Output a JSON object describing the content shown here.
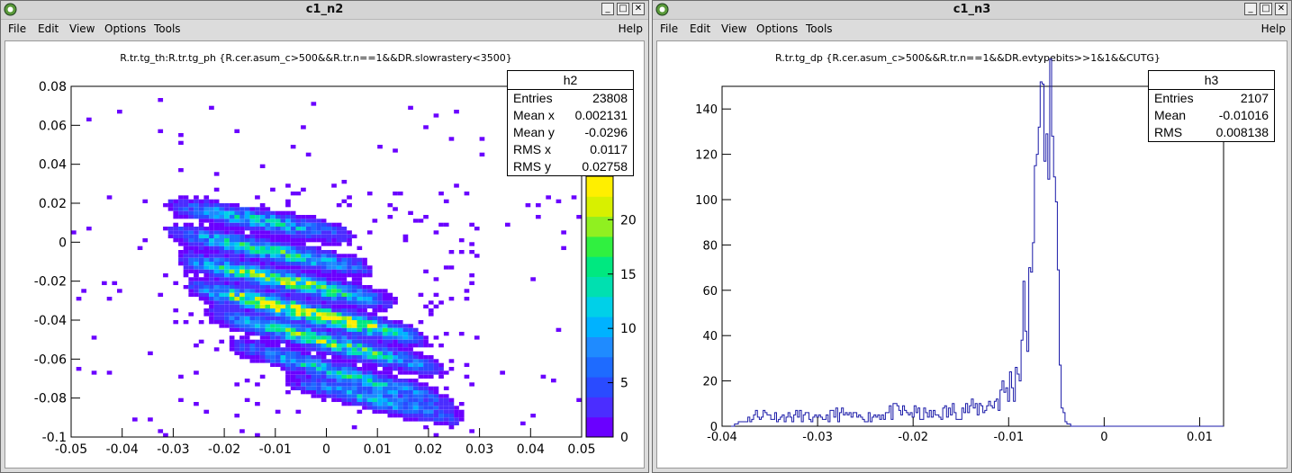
{
  "windows": [
    {
      "title": "c1_n2",
      "menu": [
        "File",
        "Edit",
        "View",
        "Options",
        "Tools"
      ],
      "help": "Help",
      "plot": {
        "title": "R.tr.tg_th:R.tr.tg_ph {R.cer.asum_c>500&&R.tr.n==1&&DR.slowrastery<3500}",
        "stats": {
          "name": "h2",
          "rows": [
            {
              "label": "Entries",
              "value": "23808"
            },
            {
              "label": "Mean x",
              "value": "0.002131"
            },
            {
              "label": "Mean y",
              "value": "-0.0296"
            },
            {
              "label": "RMS x",
              "value": "0.0117"
            },
            {
              "label": "RMS y",
              "value": "0.02758"
            }
          ]
        },
        "x_ticks": [
          "-0.05",
          "-0.04",
          "-0.03",
          "-0.02",
          "-0.01",
          "0",
          "0.01",
          "0.02",
          "0.03",
          "0.04",
          "0.05"
        ],
        "y_ticks": [
          "0.08",
          "0.06",
          "0.04",
          "0.02",
          "0",
          "-0.02",
          "-0.04",
          "-0.06",
          "-0.08",
          "-0.1"
        ],
        "palette_ticks": [
          "20",
          "15",
          "10",
          "5",
          "0"
        ]
      }
    },
    {
      "title": "c1_n3",
      "menu": [
        "File",
        "Edit",
        "View",
        "Options",
        "Tools"
      ],
      "help": "Help",
      "plot": {
        "title": "R.tr.tg_dp {R.cer.asum_c>500&&R.tr.n==1&&DR.evtypebits>>1&1&&CUTG}",
        "stats": {
          "name": "h3",
          "rows": [
            {
              "label": "Entries",
              "value": "2107"
            },
            {
              "label": "Mean",
              "value": "-0.01016"
            },
            {
              "label": "RMS",
              "value": "0.008138"
            }
          ]
        },
        "x_ticks": [
          "-0.04",
          "-0.03",
          "-0.02",
          "-0.01",
          "0",
          "0.01"
        ],
        "y_ticks": [
          "140",
          "120",
          "100",
          "80",
          "60",
          "40",
          "20",
          "0"
        ]
      }
    }
  ],
  "chart_data": [
    {
      "type": "heatmap",
      "title": "R.tr.tg_th:R.tr.tg_ph {R.cer.asum_c>500&&R.tr.n==1&&DR.slowrastery<3500}",
      "xlim": [
        -0.05,
        0.05
      ],
      "ylim": [
        -0.1,
        0.08
      ],
      "zlim": [
        0,
        24
      ],
      "palette": [
        "#6a00ff",
        "#4b2dff",
        "#2a4bff",
        "#1e6bff",
        "#1f8bff",
        "#00b2ff",
        "#00d0e8",
        "#00e0b0",
        "#00e880",
        "#30f040",
        "#90f020",
        "#d8f000",
        "#ffef00"
      ],
      "bands": [
        {
          "x0": -0.028,
          "x1": 0.002,
          "y": 0.018,
          "slope": -0.45,
          "peak": 12
        },
        {
          "x0": -0.028,
          "x1": 0.006,
          "y": 0.004,
          "slope": -0.5,
          "peak": 14
        },
        {
          "x0": -0.026,
          "x1": 0.01,
          "y": -0.01,
          "slope": -0.55,
          "peak": 18
        },
        {
          "x0": -0.024,
          "x1": 0.016,
          "y": -0.024,
          "slope": -0.6,
          "peak": 24
        },
        {
          "x0": -0.02,
          "x1": 0.02,
          "y": -0.038,
          "slope": -0.65,
          "peak": 16
        },
        {
          "x0": -0.016,
          "x1": 0.022,
          "y": -0.054,
          "slope": -0.7,
          "peak": 12
        },
        {
          "x0": -0.005,
          "x1": 0.024,
          "y": -0.072,
          "slope": -0.6,
          "peak": 10
        }
      ]
    },
    {
      "type": "line",
      "title": "R.tr.tg_dp {R.cer.asum_c>500&&R.tr.n==1&&DR.evtypebits>>1&1&&CUTG}",
      "xlim": [
        -0.04,
        0.0125
      ],
      "ylim": [
        0,
        150
      ],
      "x": [
        -0.0395,
        -0.038,
        -0.036,
        -0.034,
        -0.032,
        -0.03,
        -0.028,
        -0.026,
        -0.024,
        -0.022,
        -0.02,
        -0.018,
        -0.016,
        -0.014,
        -0.012,
        -0.011,
        -0.01,
        -0.0095,
        -0.009,
        -0.0085,
        -0.008,
        -0.0078,
        -0.0076,
        -0.0074,
        -0.0072,
        -0.007,
        -0.0068,
        -0.0066,
        -0.0064,
        -0.0062,
        -0.006,
        -0.0058,
        -0.0056,
        -0.0054,
        -0.0052,
        -0.005,
        -0.0048,
        -0.0046,
        -0.0044,
        -0.0042,
        -0.004,
        -0.003,
        0.0125
      ],
      "y": [
        0,
        2,
        6,
        4,
        5,
        3,
        6,
        4,
        5,
        7,
        6,
        5,
        7,
        8,
        10,
        14,
        18,
        22,
        30,
        45,
        60,
        68,
        80,
        95,
        110,
        125,
        138,
        146,
        132,
        142,
        118,
        138,
        146,
        130,
        100,
        72,
        40,
        18,
        8,
        3,
        1,
        0,
        0
      ]
    }
  ]
}
